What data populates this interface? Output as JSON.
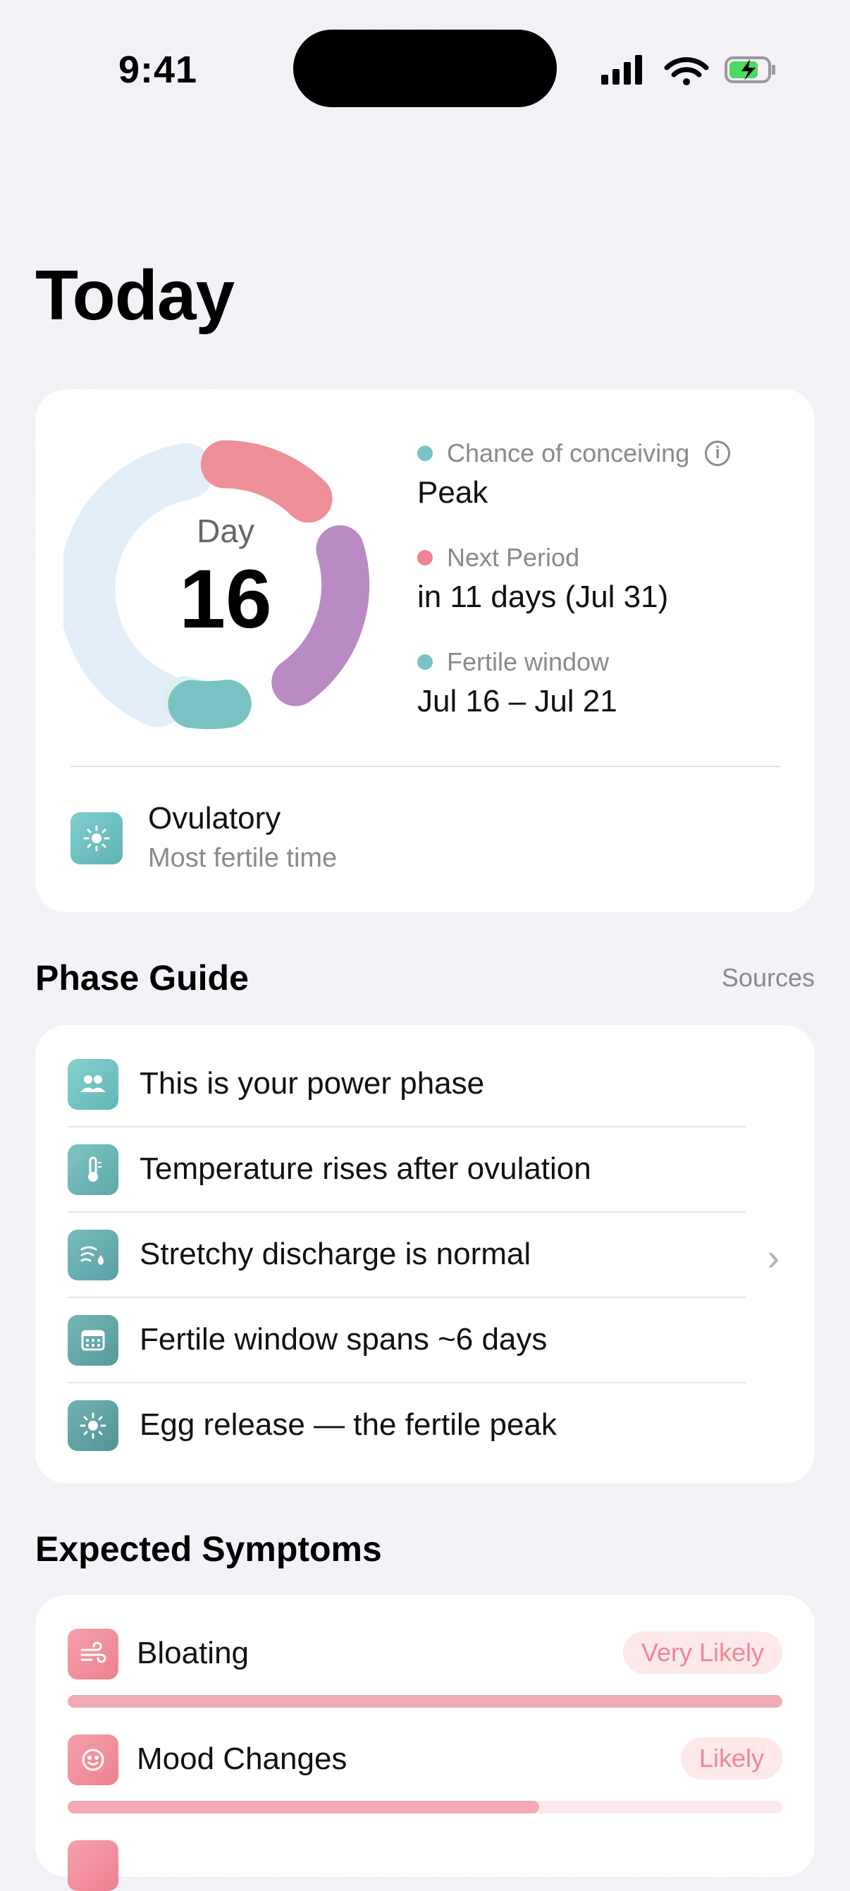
{
  "status": {
    "time": "9:41"
  },
  "page": {
    "title": "Today"
  },
  "cycle": {
    "day_label": "Day",
    "day_number": "16",
    "stats": [
      {
        "label": "Chance of conceiving",
        "value": "Peak",
        "color": "#7ac4c4",
        "info_icon": "info-icon"
      },
      {
        "label": "Next Period",
        "value": "in 11 days (Jul 31)",
        "color": "#ef8592"
      },
      {
        "label": "Fertile window",
        "value": "Jul 16 – Jul 21",
        "color": "#7ac4c4"
      }
    ],
    "colors": {
      "period": "#ef8f98",
      "fertile": "#7fc6c6",
      "luteal": "#b98ac4",
      "follicular": "#e3eef8"
    },
    "phase": {
      "name": "Ovulatory",
      "description": "Most fertile time",
      "icon": "sun-icon"
    }
  },
  "phase_guide": {
    "title": "Phase Guide",
    "sources_label": "Sources",
    "items": [
      {
        "text": "This is your power phase",
        "icon": "people-icon"
      },
      {
        "text": "Temperature rises after ovulation",
        "icon": "thermometer-icon"
      },
      {
        "text": "Stretchy discharge is normal",
        "icon": "droplet-wind-icon"
      },
      {
        "text": "Fertile window spans ~6 days",
        "icon": "calendar-icon"
      },
      {
        "text": "Egg release — the fertile peak",
        "icon": "sun-icon"
      }
    ]
  },
  "symptoms": {
    "title": "Expected Symptoms",
    "items": [
      {
        "name": "Bloating",
        "likelihood": "Very Likely",
        "level": 1.0,
        "icon": "wind-icon"
      },
      {
        "name": "Mood Changes",
        "likelihood": "Likely",
        "level": 0.66,
        "icon": "smile-icon"
      }
    ]
  }
}
